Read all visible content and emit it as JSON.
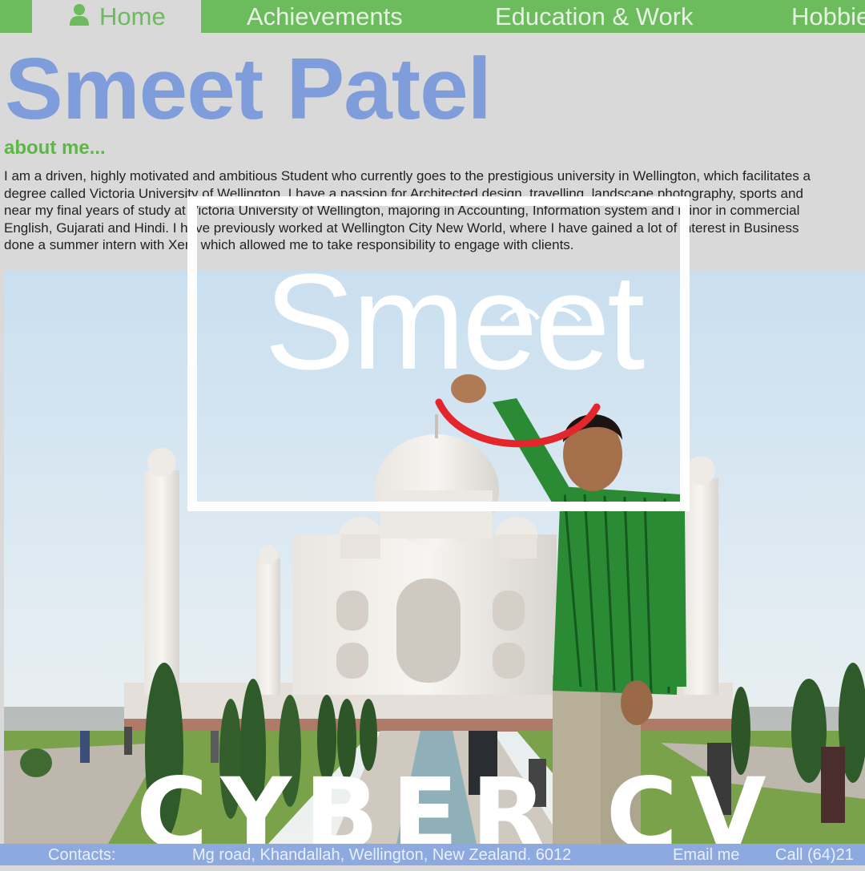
{
  "nav": {
    "home": "Home",
    "achievements": "Achievements",
    "education": "Education & Work",
    "hobbies": "Hobbies"
  },
  "hero": {
    "name": "Smeet Patel",
    "subheading": "about me...",
    "bio_lines": [
      "I am a driven, highly motivated and ambitious Student who currently goes to the prestigious university in Wellington, which facilitates a",
      "degree called Victoria University of Wellington. I have a passion for Architected design, travelling, landscape photography, sports and",
      "near my final years of study at Victoria University of Wellington, majoring in Accounting, Information system and minor in commercial",
      "English, Gujarati and Hindi. I have previously worked at Wellington City New World, where I have gained a lot of interest in Business",
      "done a summer intern with Xero which allowed me to take responsibility to engage with clients."
    ]
  },
  "overlay": {
    "logo": "Smeet",
    "caption": "CYBER CV"
  },
  "footer": {
    "contacts": "Contacts:",
    "address": "Mg road, Khandallah, Wellington, New Zealand. 6012",
    "email": "Email me",
    "call": "Call (64)21"
  },
  "colors": {
    "nav_green": "#6cbb5c",
    "title_blue": "#7f9cdb",
    "footer_blue": "#8ca9e0",
    "smile_red": "#e3262b"
  }
}
